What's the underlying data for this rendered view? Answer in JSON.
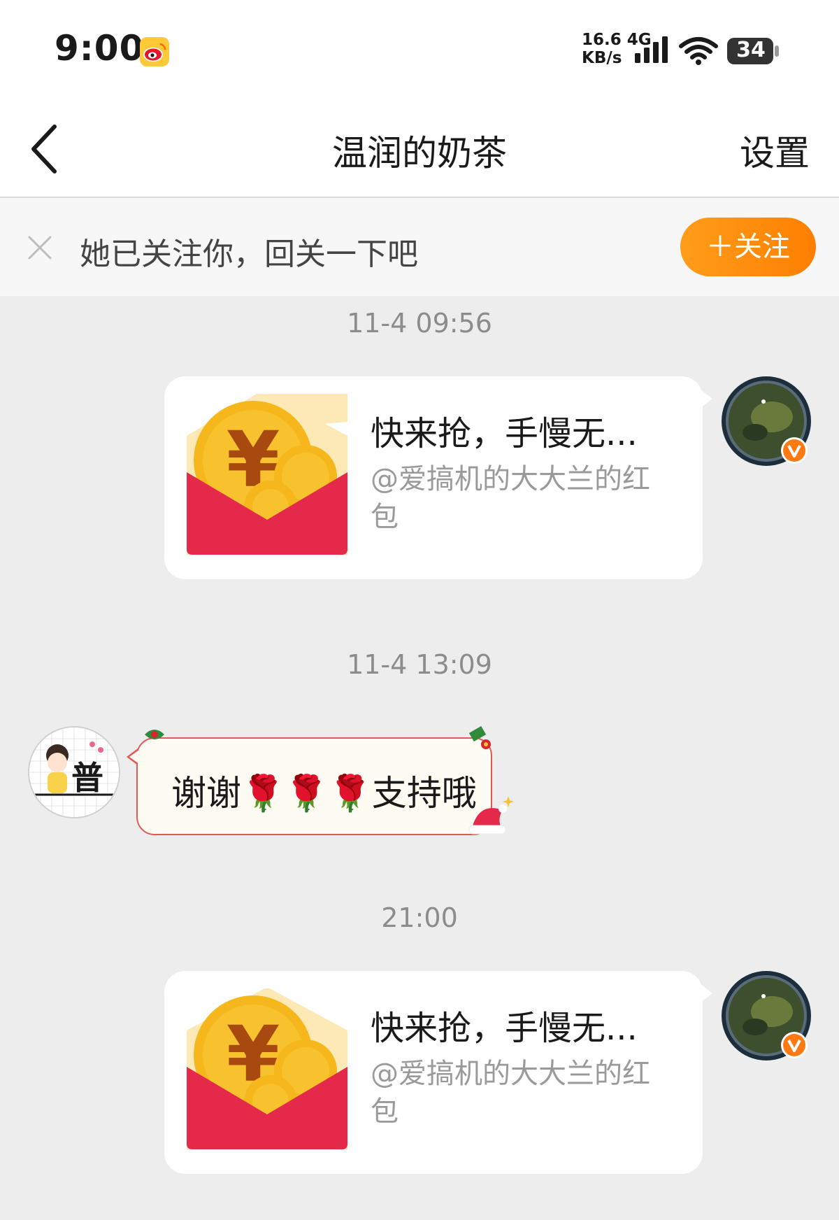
{
  "status_bar": {
    "time": "9:00",
    "net_speed_value": "16.6 4G",
    "net_speed_unit": "KB/s",
    "battery": "34"
  },
  "nav": {
    "title": "温润的奶茶",
    "settings_label": "设置"
  },
  "follow_banner": {
    "tip": "她已关注你，回关一下吧",
    "button_label": "＋关注"
  },
  "messages": [
    {
      "timestamp": "11-4 09:56",
      "type": "redpacket",
      "title": "快来抢，手慢无...",
      "subtitle": "@爱搞机的大大兰的红包"
    },
    {
      "timestamp": "11-4 13:09",
      "type": "text",
      "text": "谢谢🌹🌹🌹支持哦"
    },
    {
      "timestamp": "21:00",
      "type": "redpacket",
      "title": "快来抢，手慢无...",
      "subtitle": "@爱搞机的大大兰的红包"
    }
  ],
  "other_avatar": {
    "glyph": "普"
  },
  "colors": {
    "accent_orange": "#ff8a0d",
    "redpacket_red": "#e5294a",
    "coin_gold": "#f5b71b",
    "bubble_border_red": "#e05a5a"
  },
  "icons": [
    "weibo-icon",
    "signal-icon",
    "wifi-icon",
    "battery-icon",
    "back-icon",
    "close-icon",
    "redpacket-icon",
    "verified-icon"
  ]
}
